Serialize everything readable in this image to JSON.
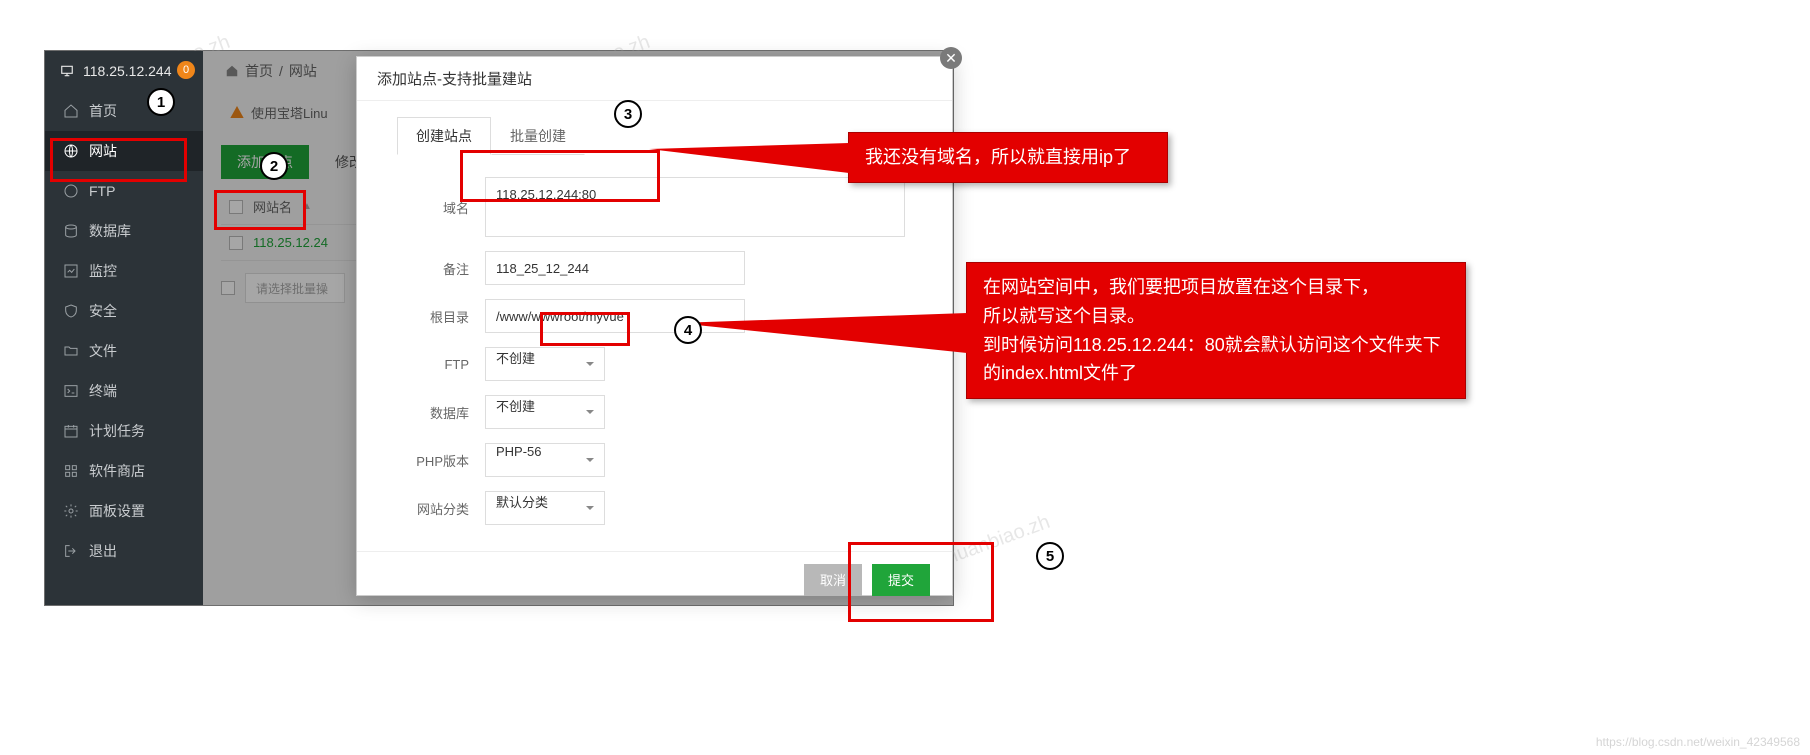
{
  "header": {
    "ip": "118.25.12.244",
    "badge": "0"
  },
  "sidebar": {
    "items": [
      {
        "label": "首页"
      },
      {
        "label": "网站",
        "active": true
      },
      {
        "label": "FTP"
      },
      {
        "label": "数据库"
      },
      {
        "label": "监控"
      },
      {
        "label": "安全"
      },
      {
        "label": "文件"
      },
      {
        "label": "终端"
      },
      {
        "label": "计划任务"
      },
      {
        "label": "软件商店"
      },
      {
        "label": "面板设置"
      },
      {
        "label": "退出"
      }
    ]
  },
  "breadcrumb": {
    "home": "首页",
    "sep": "/",
    "current": "网站"
  },
  "warning": "使用宝塔Linu",
  "buttons": {
    "add": "添加站点",
    "modify": "修改"
  },
  "table": {
    "header_site": "网站名",
    "row_site": "118.25.12.24",
    "bulk_placeholder": "请选择批量操"
  },
  "modal": {
    "title": "添加站点-支持批量建站",
    "tabs": {
      "create": "创建站点",
      "batch": "批量创建"
    },
    "labels": {
      "domain": "域名",
      "remark": "备注",
      "root": "根目录",
      "ftp": "FTP",
      "db": "数据库",
      "php": "PHP版本",
      "cat": "网站分类"
    },
    "values": {
      "domain": "118.25.12.244:80",
      "remark": "118_25_12_244",
      "root": "/www/wwwroot/myvue",
      "ftp": "不创建",
      "db": "不创建",
      "php": "PHP-56",
      "cat": "默认分类"
    },
    "footer": {
      "cancel": "取消",
      "submit": "提交"
    }
  },
  "annotations": {
    "n1": "1",
    "n2": "2",
    "n3": "3",
    "n4": "4",
    "n5": "5",
    "co1": "我还没有域名，所以就直接用ip了",
    "co2_l1": "在网站空间中，我们要把项目放置在这个目录下，",
    "co2_l2": "所以就写这个目录。",
    "co2_l3": "到时候访问118.25.12.244：80就会默认访问这个文件夹下",
    "co2_l4": "的index.html文件了"
  },
  "credit": "https://blog.csdn.net/weixin_42349568"
}
